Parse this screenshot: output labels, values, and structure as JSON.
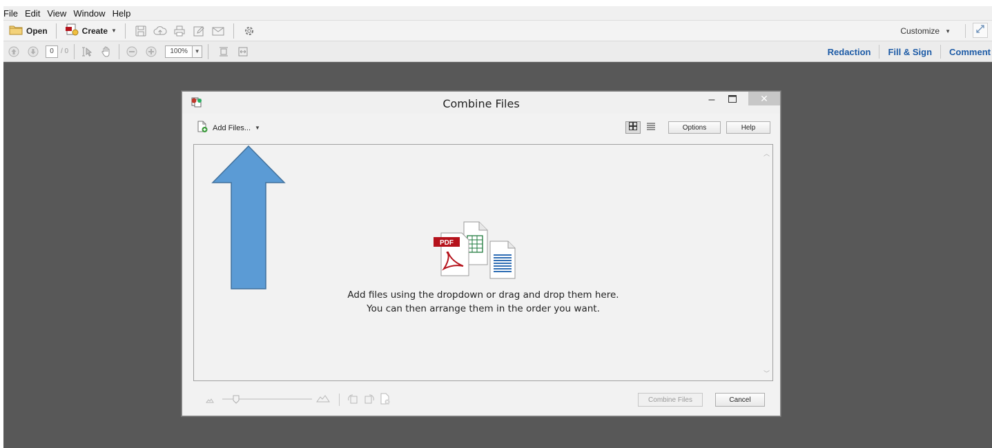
{
  "menubar": {
    "items": [
      "File",
      "Edit",
      "View",
      "Window",
      "Help"
    ]
  },
  "toolbar": {
    "open_label": "Open",
    "create_label": "Create",
    "page_current": "0",
    "page_total": "/ 0",
    "zoom_value": "100%",
    "customize_label": "Customize"
  },
  "panes": {
    "redaction": "Redaction",
    "fill_sign": "Fill & Sign",
    "comment": "Comment"
  },
  "dialog": {
    "title": "Combine Files",
    "add_files_label": "Add Files...",
    "options_label": "Options",
    "help_label": "Help",
    "hint_line1": "Add files using the dropdown or drag and drop them here.",
    "hint_line2": "You can then arrange them in the order you want.",
    "illustration_badge": "PDF",
    "combine_label": "Combine Files",
    "cancel_label": "Cancel"
  },
  "colors": {
    "workspace_bg": "#585858",
    "pane_link": "#1d5ba6",
    "annotation_arrow": "#5b9bd5",
    "annotation_arrow_stroke": "#41719c",
    "pdf_red": "#b5121b",
    "sheet_green": "#1e7a3c",
    "doc_blue": "#2e6db4"
  },
  "icons": {
    "open": "folder-icon",
    "create": "create-pdf-icon",
    "save": "save-icon",
    "upload": "cloud-upload-icon",
    "print": "print-icon",
    "edit": "edit-icon",
    "email": "email-icon",
    "settings": "gear-icon"
  }
}
